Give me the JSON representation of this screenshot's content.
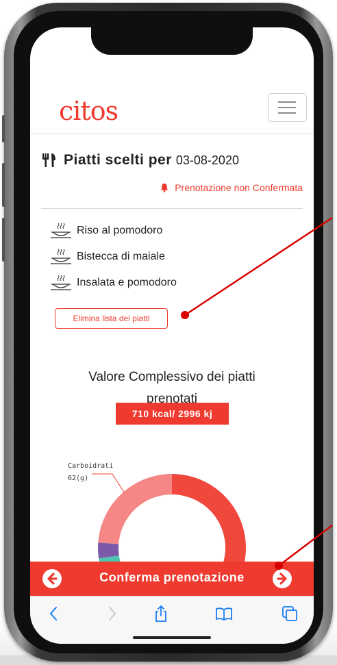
{
  "app": {
    "logo_text": "citos"
  },
  "header": {
    "title": "Piatti scelti per",
    "date": "03-08-2020",
    "status": "Prenotazione non Confermata"
  },
  "dishes": [
    {
      "label": "Riso al pomodoro"
    },
    {
      "label": "Bistecca di maiale"
    },
    {
      "label": "Insalata e pomodoro"
    }
  ],
  "actions": {
    "delete_list": "Elimina lista dei piatti"
  },
  "summary": {
    "title_line1": "Valore Complessivo dei piatti",
    "title_line2": "prenotati",
    "kcal": "710 kcal/ 2996 kj"
  },
  "chart_data": {
    "type": "pie",
    "style": "donut",
    "slices": [
      {
        "label": "Carboidrati",
        "value": 62,
        "unit": "g",
        "color": "#f0483c",
        "label_text": "62(g)"
      },
      {
        "label": "",
        "value": 2,
        "color": "#4fc4b0"
      },
      {
        "label": "",
        "value": 3,
        "color": "#7d5aa9"
      },
      {
        "label": "",
        "value": 21,
        "color": "#f58787"
      }
    ]
  },
  "cta": {
    "label": "Conferma prenotazione"
  },
  "colors": {
    "accent": "#ef3b2f",
    "text": "#222222",
    "toolbar_icon": "#1a7cf5"
  },
  "icons": {
    "title": "cutlery-icon",
    "status": "bell-icon",
    "dish": "dish-icon",
    "cta_left": "arrow-left-circle-icon",
    "cta_right": "arrow-right-circle-icon",
    "toolbar": [
      "back-icon",
      "forward-icon",
      "share-icon",
      "bookmarks-icon",
      "tabs-icon"
    ]
  }
}
